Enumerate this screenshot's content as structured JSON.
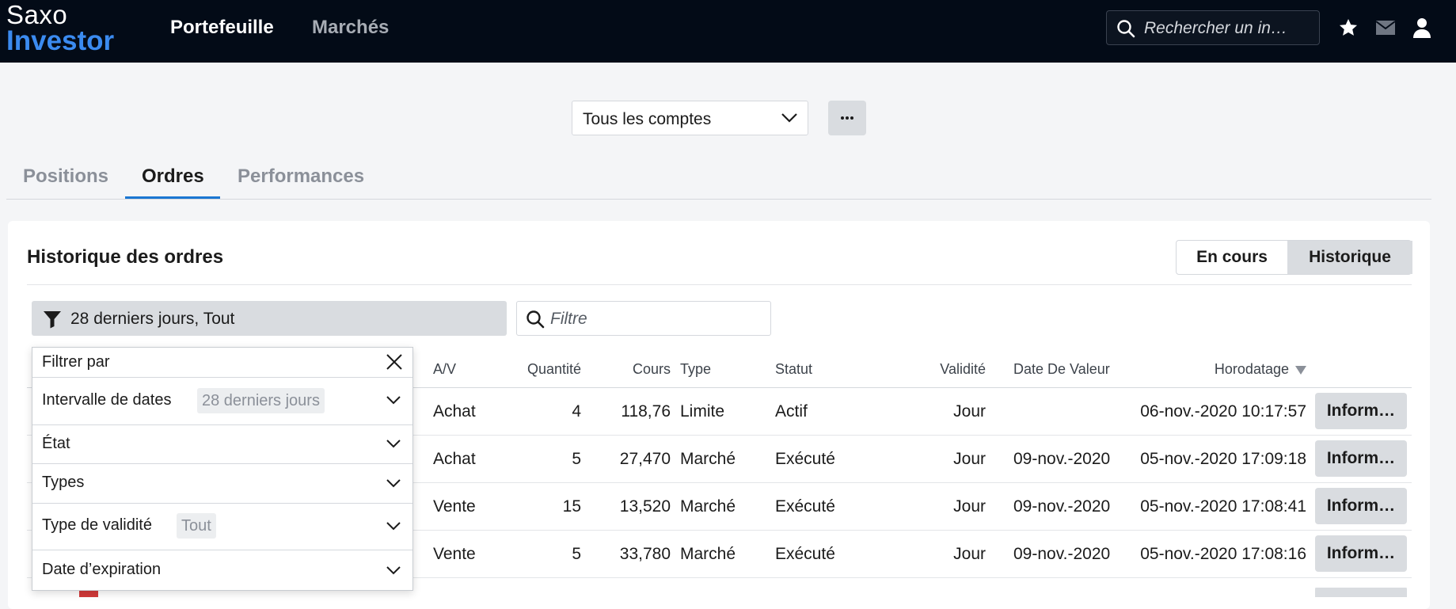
{
  "app": {
    "logo_line1": "Saxo",
    "logo_line2": "Investor",
    "nav": [
      "Portefeuille",
      "Marchés"
    ],
    "search_placeholder": "Rechercher un in…",
    "icons": [
      "search-icon",
      "star-icon",
      "mail-icon",
      "user-icon"
    ]
  },
  "account_select": {
    "value": "Tous les comptes"
  },
  "tabs": [
    "Positions",
    "Ordres",
    "Performances"
  ],
  "active_tab": "Ordres",
  "card": {
    "title": "Historique des ordres",
    "toggle": [
      "En cours",
      "Historique"
    ],
    "active_toggle": "Historique",
    "filter_summary": "28 derniers jours, Tout",
    "filter_placeholder": "Filtre"
  },
  "table": {
    "columns": [
      "A/V",
      "Quantité",
      "Cours",
      "Type",
      "Statut",
      "Validité",
      "Date De Valeur",
      "Horodatage"
    ],
    "rows": [
      {
        "av": "Achat",
        "qty": "4",
        "price": "118,76",
        "type": "Limite",
        "status": "Actif",
        "validity": "Jour",
        "value_date": "",
        "timestamp": "06-nov.-2020 10:17:57",
        "action": "Inform…"
      },
      {
        "av": "Achat",
        "qty": "5",
        "price": "27,470",
        "type": "Marché",
        "status": "Exécuté",
        "validity": "Jour",
        "value_date": "09-nov.-2020",
        "timestamp": "05-nov.-2020 17:09:18",
        "action": "Inform…"
      },
      {
        "av": "Vente",
        "qty": "15",
        "price": "13,520",
        "type": "Marché",
        "status": "Exécuté",
        "validity": "Jour",
        "value_date": "09-nov.-2020",
        "timestamp": "05-nov.-2020 17:08:41",
        "action": "Inform…"
      },
      {
        "av": "Vente",
        "qty": "5",
        "price": "33,780",
        "type": "Marché",
        "status": "Exécuté",
        "validity": "Jour",
        "value_date": "09-nov.-2020",
        "timestamp": "05-nov.-2020 17:08:16",
        "action": "Inform…"
      }
    ]
  },
  "filter_panel": {
    "title": "Filtrer par",
    "items": [
      {
        "label": "Intervalle de dates",
        "chip": "28 derniers jours"
      },
      {
        "label": "État",
        "chip": ""
      },
      {
        "label": "Types",
        "chip": ""
      },
      {
        "label": "Type de validité",
        "chip": "Tout"
      },
      {
        "label": "Date d’expiration",
        "chip": ""
      }
    ]
  },
  "colors": {
    "topbar": "#030b17",
    "brand_blue": "#3b8bf0",
    "tab_active": "#1a76d2",
    "flag_red": "#d23a3a"
  }
}
